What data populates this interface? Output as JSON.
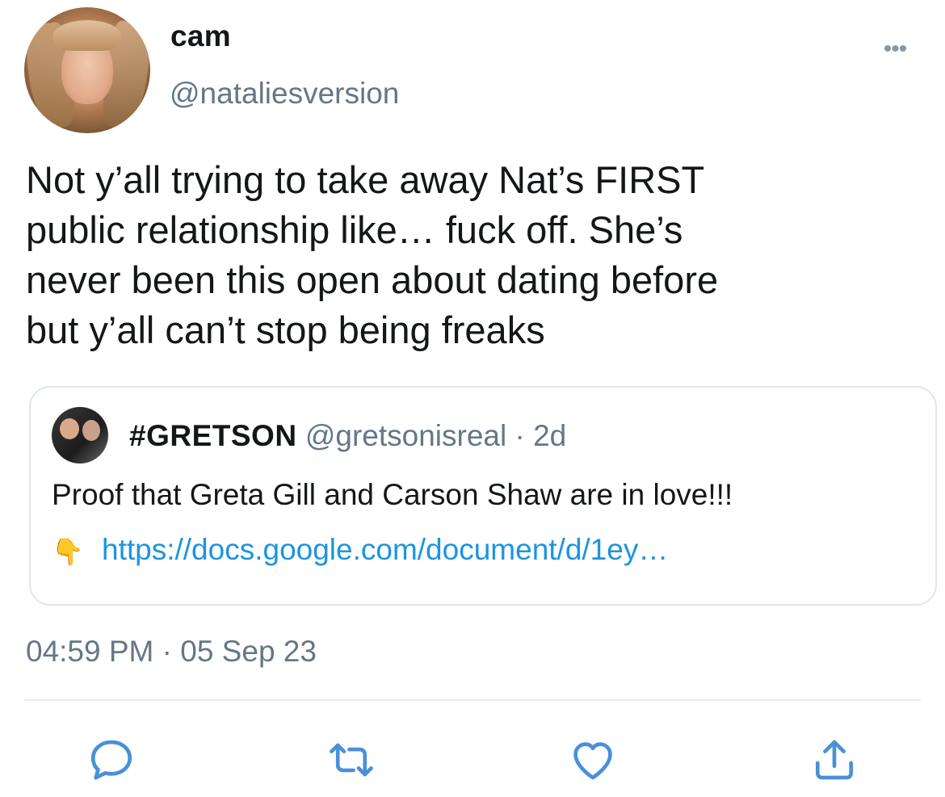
{
  "tweet": {
    "author_name": "cam",
    "author_handle": "@nataliesversion",
    "more_label": "•••",
    "text": "Not y’all trying to take away Nat’s FIRST\npublic relationship like… fuck off. She’s\nnever been this open about dating before\nbut y’all can’t stop being freaks",
    "timestamp": "04:59 PM · 05 Sep 23"
  },
  "quote": {
    "name": "#GRETSON",
    "handle": "@gretsonisreal",
    "separator": "·",
    "time": "2d",
    "text": "Proof that Greta Gill and Carson Shaw are in love!!!",
    "emoji": "👇",
    "link": "https://docs.google.com/document/d/1ey…"
  },
  "actions": {
    "icons": [
      "reply-icon",
      "retweet-icon",
      "like-icon",
      "share-icon"
    ]
  },
  "colors": {
    "text": "#14171a",
    "secondary": "#657786",
    "link": "#1b95e0",
    "icon": "#4a90d9",
    "border": "#dfe6ec"
  }
}
